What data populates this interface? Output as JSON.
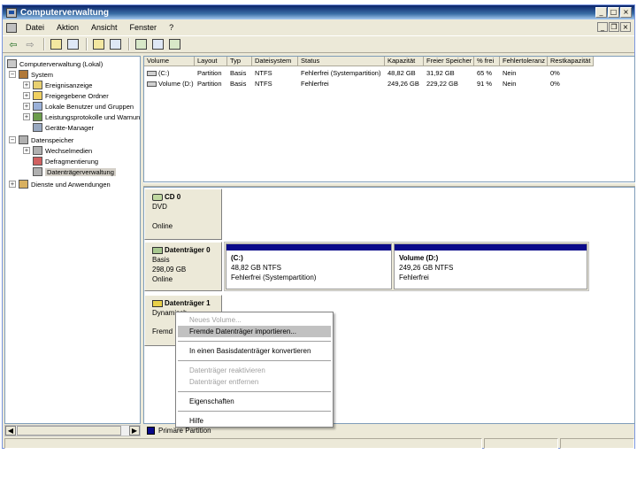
{
  "window": {
    "title": "Computerverwaltung",
    "caption_buttons": {
      "minimize": "_",
      "maximize": "□",
      "close": "×"
    }
  },
  "menu": {
    "items": [
      "Datei",
      "Aktion",
      "Ansicht",
      "Fenster",
      "?"
    ],
    "mdi_buttons": {
      "minimize": "_",
      "restore": "❐",
      "close": "×"
    }
  },
  "toolbar": {
    "back_icon": "arrow-left-icon",
    "forward_icon": "arrow-right-icon",
    "back_glyph": "⇦",
    "forward_glyph": "⇨"
  },
  "tree": {
    "items": [
      {
        "label": "Computerverwaltung (Lokal)",
        "icon": "computer-icon"
      },
      {
        "label": "System",
        "icon": "tools-icon"
      },
      {
        "label": "Ereignisanzeige",
        "icon": "event-viewer-icon"
      },
      {
        "label": "Freigegebene Ordner",
        "icon": "shared-folder-icon"
      },
      {
        "label": "Lokale Benutzer und Gruppen",
        "icon": "users-icon"
      },
      {
        "label": "Leistungsprotokolle und Warnungen",
        "icon": "performance-icon"
      },
      {
        "label": "Geräte-Manager",
        "icon": "device-manager-icon"
      },
      {
        "label": "Datenspeicher",
        "icon": "storage-icon"
      },
      {
        "label": "Wechselmedien",
        "icon": "removable-media-icon"
      },
      {
        "label": "Defragmentierung",
        "icon": "defrag-icon"
      },
      {
        "label": "Datenträgerverwaltung",
        "icon": "disk-management-icon"
      },
      {
        "label": "Dienste und Anwendungen",
        "icon": "services-icon"
      }
    ],
    "expanders": {
      "plus": "+",
      "minus": "−"
    }
  },
  "volume_list": {
    "columns": [
      "Volume",
      "Layout",
      "Typ",
      "Dateisystem",
      "Status",
      "Kapazität",
      "Freier Speicher",
      "% frei",
      "Fehlertoleranz",
      "Restkapazität"
    ],
    "rows": [
      [
        "(C:)",
        "Partition",
        "Basis",
        "NTFS",
        "Fehlerfrei (Systempartition)",
        "48,82 GB",
        "31,92 GB",
        "65 %",
        "Nein",
        "0%"
      ],
      [
        "Volume (D:)",
        "Partition",
        "Basis",
        "NTFS",
        "Fehlerfrei",
        "249,26 GB",
        "229,22 GB",
        "91 %",
        "Nein",
        "0%"
      ]
    ]
  },
  "disks": {
    "cd0": {
      "name": "CD 0",
      "type": "DVD",
      "status": "Online"
    },
    "disk0": {
      "name": "Datenträger 0",
      "type": "Basis",
      "size": "298,09 GB",
      "status": "Online",
      "partitions": [
        {
          "name": "(C:)",
          "size": "48,82 GB NTFS",
          "status": "Fehlerfrei (Systempartition)"
        },
        {
          "name": "Volume  (D:)",
          "size": "249,26 GB NTFS",
          "status": "Fehlerfrei"
        }
      ]
    },
    "disk1": {
      "name": "Datenträger 1",
      "type": "Dynamisch",
      "status": "Fremd"
    }
  },
  "legend": {
    "label": "Primäre Partition",
    "color": "#0a0a8a"
  },
  "scroll_arrows": {
    "left": "◀",
    "right": "▶"
  },
  "context_menu": {
    "new_volume": "Neues Volume...",
    "import_foreign": "Fremde Datenträger importieren...",
    "convert_basic": "In einen Basisdatenträger konvertieren",
    "reactivate": "Datenträger reaktivieren",
    "remove": "Datenträger entfernen",
    "properties": "Eigenschaften",
    "help": "Hilfe"
  }
}
